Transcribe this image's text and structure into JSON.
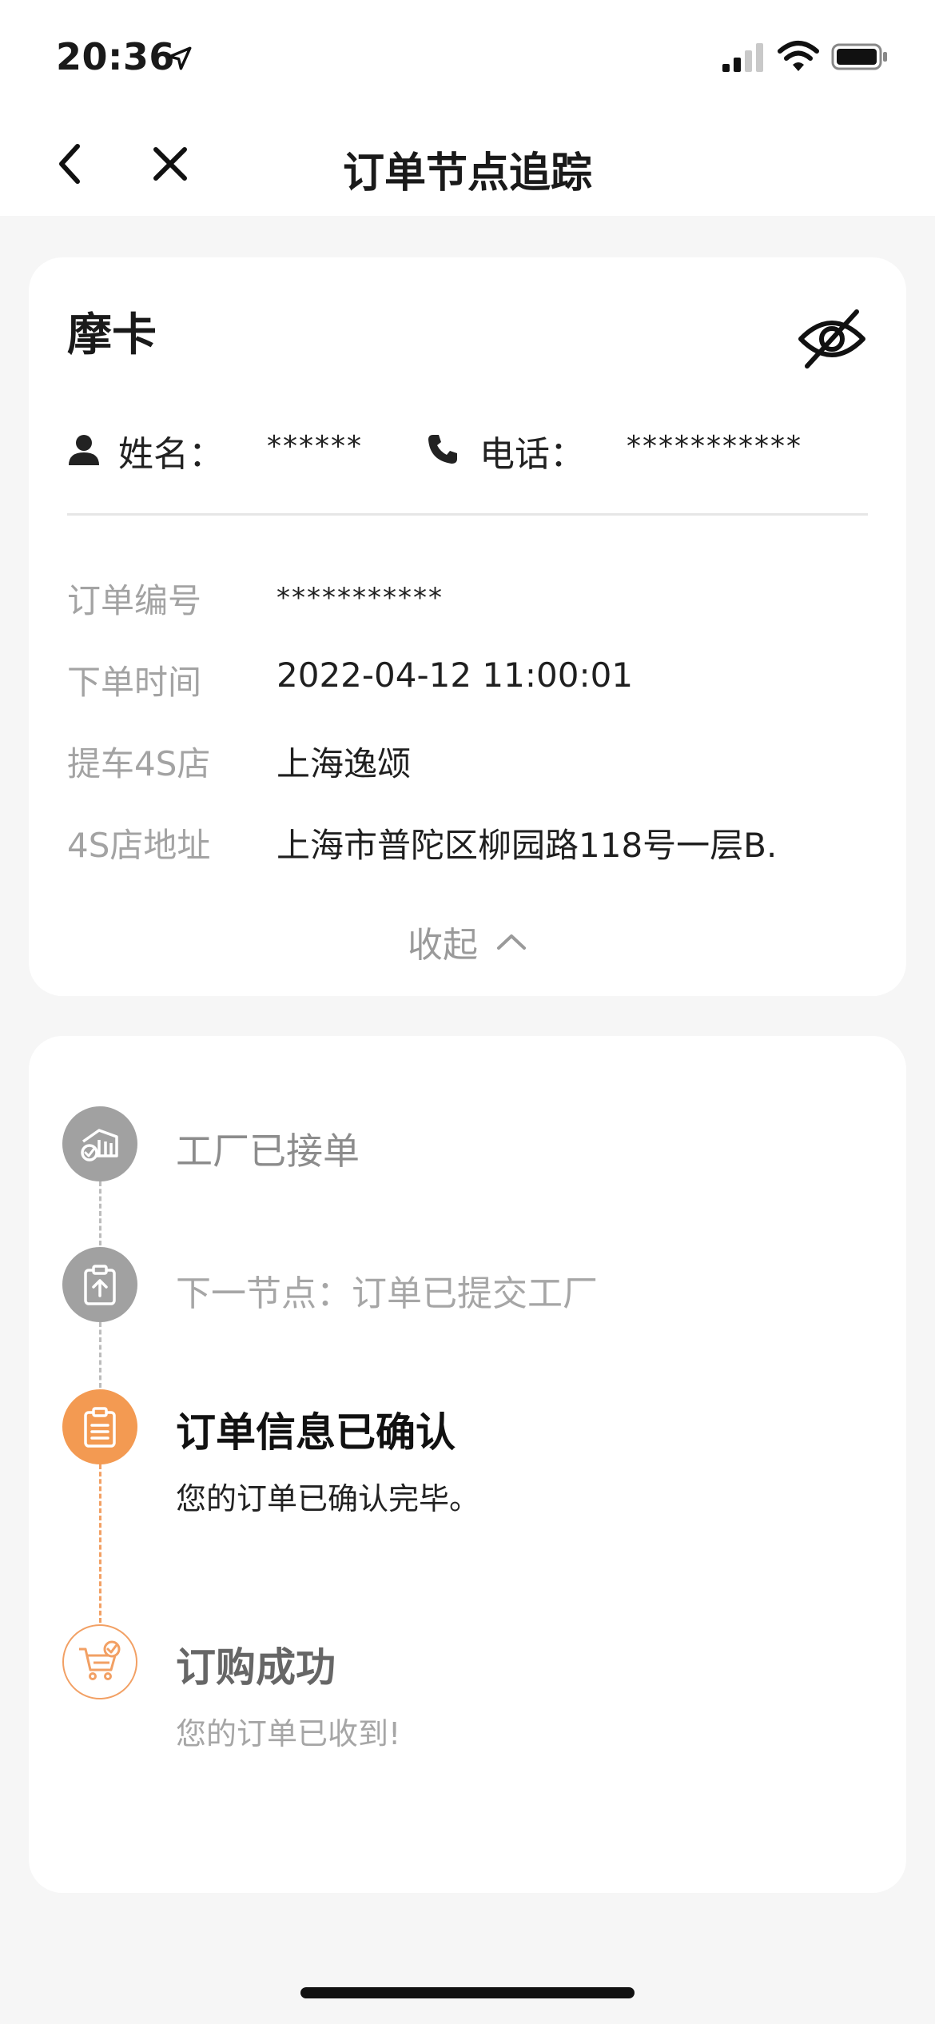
{
  "status_bar": {
    "time": "20:36"
  },
  "nav": {
    "title": "订单节点追踪"
  },
  "order_card": {
    "car_name": "摩卡",
    "contact": {
      "name_label": "姓名：",
      "name_value": "******",
      "phone_label": "电话：",
      "phone_value": "***********"
    },
    "rows": [
      {
        "label": "订单编号",
        "value": "***********"
      },
      {
        "label": "下单时间",
        "value": "2022-04-12 11:00:01"
      },
      {
        "label": "提车4S店",
        "value": "上海逸颂"
      },
      {
        "label": "4S店地址",
        "value": "上海市普陀区柳园路118号一层B."
      }
    ],
    "collapse_label": "收起"
  },
  "timeline": {
    "steps": [
      {
        "title": "工厂已接单",
        "subtitle": "",
        "state": "pending",
        "icon": "factory-icon"
      },
      {
        "title": "下一节点：订单已提交工厂",
        "subtitle": "",
        "state": "pending",
        "icon": "clipboard-upload-icon"
      },
      {
        "title": "订单信息已确认",
        "subtitle": "您的订单已确认完毕。",
        "state": "current",
        "icon": "clipboard-list-icon"
      },
      {
        "title": "订购成功",
        "subtitle": "您的订单已收到!",
        "state": "done",
        "icon": "cart-check-icon"
      }
    ]
  },
  "colors": {
    "accent_orange": "#f39a52",
    "pending_gray": "#a1a1a1",
    "label_gray": "#a3a3a3"
  }
}
